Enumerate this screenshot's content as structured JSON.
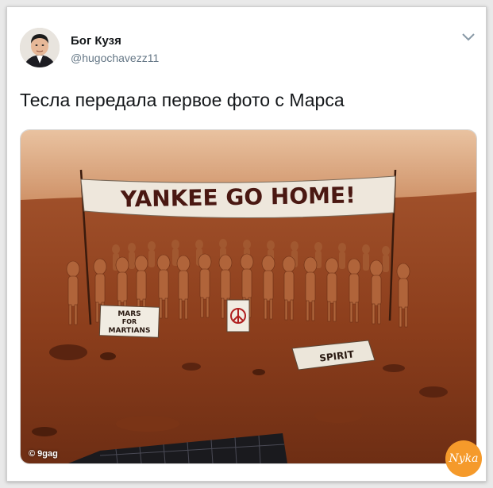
{
  "tweet": {
    "author_name": "Бог Кузя",
    "handle": "@hugochavezz11",
    "text": "Тесла передала первое фото с Марса"
  },
  "photo": {
    "banner_text": "YANKEE GO HOME!",
    "sign_left_lines": [
      "MARS",
      "FOR",
      "MARTIANS"
    ],
    "sign_right_text": "SPIRIT",
    "credit": "© 9gag"
  },
  "watermark": {
    "text": "Nyka"
  },
  "icons": {
    "caret": "chevron-down-icon",
    "avatar": "avatar",
    "peace": "peace-sign-icon"
  },
  "colors": {
    "name": "#14171a",
    "handle": "#657786",
    "mars_ground": "#8c3e1c",
    "mars_sky": "#d8a074"
  }
}
